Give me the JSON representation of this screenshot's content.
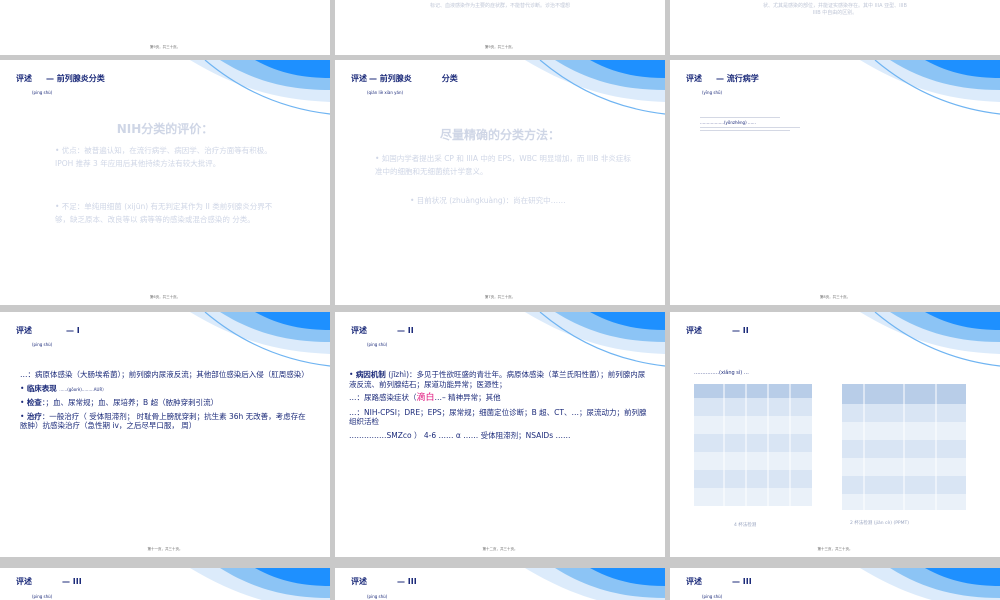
{
  "slides": {
    "s0": {
      "footer": "第9页，共三十页。"
    },
    "s1": {
      "top_text": "标记、血液感染作为主要的症状群，不能替代诊断。诊治不理想",
      "footer": "第9页，共三十页。"
    },
    "s2": {
      "top_text": "状、尤其是感染的部位，并能证实感染存在。其中 IIIA 亚型、IIIB",
      "top_text2": "IIIB 中自由的区别。"
    },
    "s3": {
      "section": "评述",
      "title": "— 前列腺炎分类",
      "pinyin": "(ping shù)",
      "heading": "NIH分类的评价：",
      "pos": "• 优点：被普遍认知，在流行病学、病因学、治疗方面等有积极。IPOH 推荐 3 年应用后其他持续方法有较大批评。",
      "neg": "• 不足：单纯用细菌 (xijūn) 有无判定其作为 II 类前列腺炎分界不够，缺乏原本、改良等以 病等等的感染或混合感染的 分类。",
      "footer": "第6页，共三十页。"
    },
    "s4": {
      "section": "评述",
      "title": "— 前列腺炎",
      "title2": "分类",
      "pinyin": "(qián liè xiàn yán)",
      "heading": "尽量精确的分类方法：",
      "l1": "• 如国内学者提出采 CP 和 IIIA 中的 EPS，WBC 明显增加，而 IIIB 非炎症标准中的细胞和无细菌统计学意义。",
      "l2": "• 目前状况 (zhuàngkuàng)：尚在研究中……",
      "footer": "第7页，共三十页。"
    },
    "s5": {
      "section": "评述",
      "title": "— 流行病学",
      "pinyin": "(yīng shū)",
      "mini_text": "………………(yǒnzhèng) ……",
      "footer": "第8页，共三十页。"
    },
    "s6": {
      "section": "评述",
      "title": "— I",
      "pinyin": "(ping shù)",
      "p1": "…：病原体感染（大肠埃希菌）；前列腺内尿液反流；其他部位感染后入侵（肛周感染）",
      "p2": "临床表现",
      "p2b": "……(gōorè)………AUR）",
      "p3a": "检查",
      "p3b": "：；血、尿常规；血、尿培养；B 超（脓肿穿刺引流）",
      "p4a": "治疗",
      "p4b": "：一般治疗（ 受体阻滞剂； 时耻骨上膀胱穿刺；抗生素 36h 无改善，考虑存在脓肿）抗感染治疗（急性期 iv，之后尽早口服， 周）",
      "footer": "第十一页，共三十页。"
    },
    "s7": {
      "section": "评述",
      "title": "— II",
      "pinyin": "(ping shù)",
      "p1a": "病因机制",
      "p1b": "(jīzhì)：多见于性欲旺盛的青壮年。病原体感染（革兰氏阳性菌）；前列腺内尿液反流、前列腺结石；尿道功能异常；医源性；",
      "p2a": "…：尿路感染症状（",
      "p2red": "滴白",
      "p2b": "…– 精神异常；其他",
      "p3": "…：NIH-CPSI；DRE；EPS；尿常规；细菌定位诊断；B 超、CT、…；尿流动力；前列腺组织活检",
      "p4": "……………SMZco ） 4-6 …… α …… 受体阻滞剂；NSAIDs ……",
      "footer": "第十二页，共三十页。"
    },
    "s8": {
      "section": "评述",
      "title": "— II",
      "pinyin": "……………(xiǎng sì) …",
      "cap1": "4 杯法检测",
      "cap2": "2 杯法检测 (jiǎn cè) (PPMT)",
      "footer": "第十三页，共三十页。"
    },
    "s9": {
      "section": "评述",
      "title": "— III",
      "pinyin": "(ping shù)"
    },
    "s10": {
      "section": "评述",
      "title": "— III",
      "pinyin": "(ping shù)"
    },
    "s11": {
      "section": "评述",
      "title": "— III",
      "pinyin": "(ping shù)"
    }
  },
  "colors": {
    "accent": "#1c2b7a",
    "wave": "#1e90ff",
    "highlight": "#e0147d",
    "faint": "#cfd6e6"
  }
}
